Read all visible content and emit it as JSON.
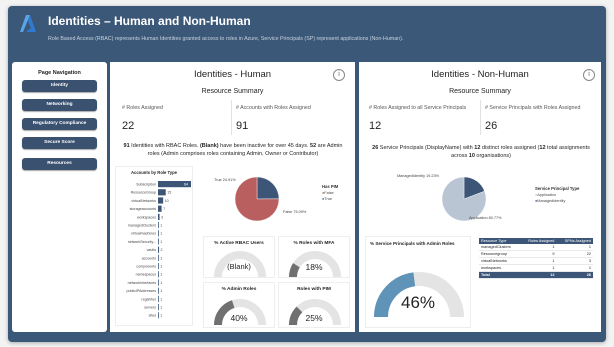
{
  "header": {
    "title": "Identities – Human and Non-Human",
    "subtitle": "Role Based Access (RBAC) represents Human Identities granted access to roles in Azure, Service Principals (SP) represent applications (Non-Human)."
  },
  "nav": {
    "title": "Page Navigation",
    "items": [
      "Identity",
      "Networking",
      "Regulatory Compliance",
      "Secure Score",
      "Resources"
    ]
  },
  "human": {
    "title": "Identities - Human",
    "summary_title": "Resource Summary",
    "roles_assigned_label": "# Roles Assigned",
    "roles_assigned_value": "22",
    "accounts_label": "# Accounts with Roles Assigned",
    "accounts_value": "91",
    "note_parts": {
      "a": "91",
      "b": " Identities with RBAC Roles. ",
      "c": "(Blank)",
      "d": " have been inactive for over 45 days. ",
      "e": "52",
      "f": " are Admin roles (Admin comprises roles containing Admin, Owner or Contributor)"
    },
    "bar_chart": {
      "title": "Accounts by Role Type",
      "rows": [
        {
          "label": "Subscription",
          "value": 64
        },
        {
          "label": "ResourceGroup",
          "value": 15
        },
        {
          "label": "virtualNetworks",
          "value": 10
        },
        {
          "label": "storageaccounts",
          "value": 7
        },
        {
          "label": "workspaces",
          "value": 3
        },
        {
          "label": "managedClusters",
          "value": 1
        },
        {
          "label": "virtualmachines",
          "value": 1
        },
        {
          "label": "networkSecurity...",
          "value": 1
        },
        {
          "label": "vaults",
          "value": 2
        },
        {
          "label": "accounts",
          "value": 1
        },
        {
          "label": "components",
          "value": 1
        },
        {
          "label": "namespaces",
          "value": 1
        },
        {
          "label": "networkInterfaces",
          "value": 1
        },
        {
          "label": "publicIPAddresses",
          "value": 1
        },
        {
          "label": "registries",
          "value": 1
        },
        {
          "label": "servers",
          "value": 1
        },
        {
          "label": "sites",
          "value": 1
        }
      ]
    },
    "pim_pie": {
      "legend_title": "Has PIM",
      "false_label": "False",
      "true_label": "True",
      "true_text": "True 24.91%",
      "false_text": "False 75.09%",
      "true_pct": 24.91,
      "false_pct": 75.09,
      "true_color": "#3d5678",
      "false_color": "#b95f5f"
    },
    "gauges": {
      "active_rbac": {
        "title": "% Active RBAC Users",
        "value": "(Blank)",
        "pct": 0
      },
      "mfa": {
        "title": "% Roles with MFA",
        "value": "18%",
        "pct": 18
      },
      "admin": {
        "title": "% Admin Roles",
        "value": "40%",
        "pct": 40
      },
      "pim": {
        "title": "Roles with PIM",
        "value": "25%",
        "pct": 25
      }
    }
  },
  "nonhuman": {
    "title": "Identities - Non-Human",
    "summary_title": "Resource Summary",
    "roles_all_sp_label": "# Roles Assigned to all Service Principals",
    "roles_all_sp_value": "12",
    "sp_roles_label": "# Service Principals with Roles Assigned",
    "sp_roles_value": "26",
    "note_parts": {
      "a": "26",
      "b": " Service Principals (DisplayName) with ",
      "c": "12",
      "d": " distinct roles assigned (",
      "e": "12",
      "f": " total assignments across ",
      "g": "10",
      "h": " organisations)"
    },
    "sp_pie": {
      "legend_title": "Service Principal Type",
      "app_label": "Application",
      "managed_label": "ManagedIdentity",
      "managed_text": "ManagedIdentity 19.23%",
      "app_text": "Application 80.77%",
      "managed_pct": 19.23,
      "app_pct": 80.77,
      "managed_color": "#3d5678",
      "app_color": "#b9c5d3"
    },
    "admin_gauge": {
      "title": "% Service Principals with Admin Roles",
      "value": "46%",
      "pct": 46
    },
    "table": {
      "headers": [
        "Resource Type",
        "Roles Assigned",
        "SPNs Assigned"
      ],
      "rows": [
        [
          "managedClusters",
          "1",
          "1"
        ],
        [
          "Resourcegroup",
          "9",
          "22"
        ],
        [
          "virtualNetworks",
          "1",
          "3"
        ],
        [
          "workspaces",
          "1",
          "1"
        ]
      ],
      "total": [
        "Total",
        "12",
        "26"
      ]
    }
  },
  "colors": {
    "accent": "#3d5678",
    "gauge_fill": "#707070",
    "gauge_bg": "#e4e4e4",
    "sp_gauge_fill": "#5f94b8"
  }
}
